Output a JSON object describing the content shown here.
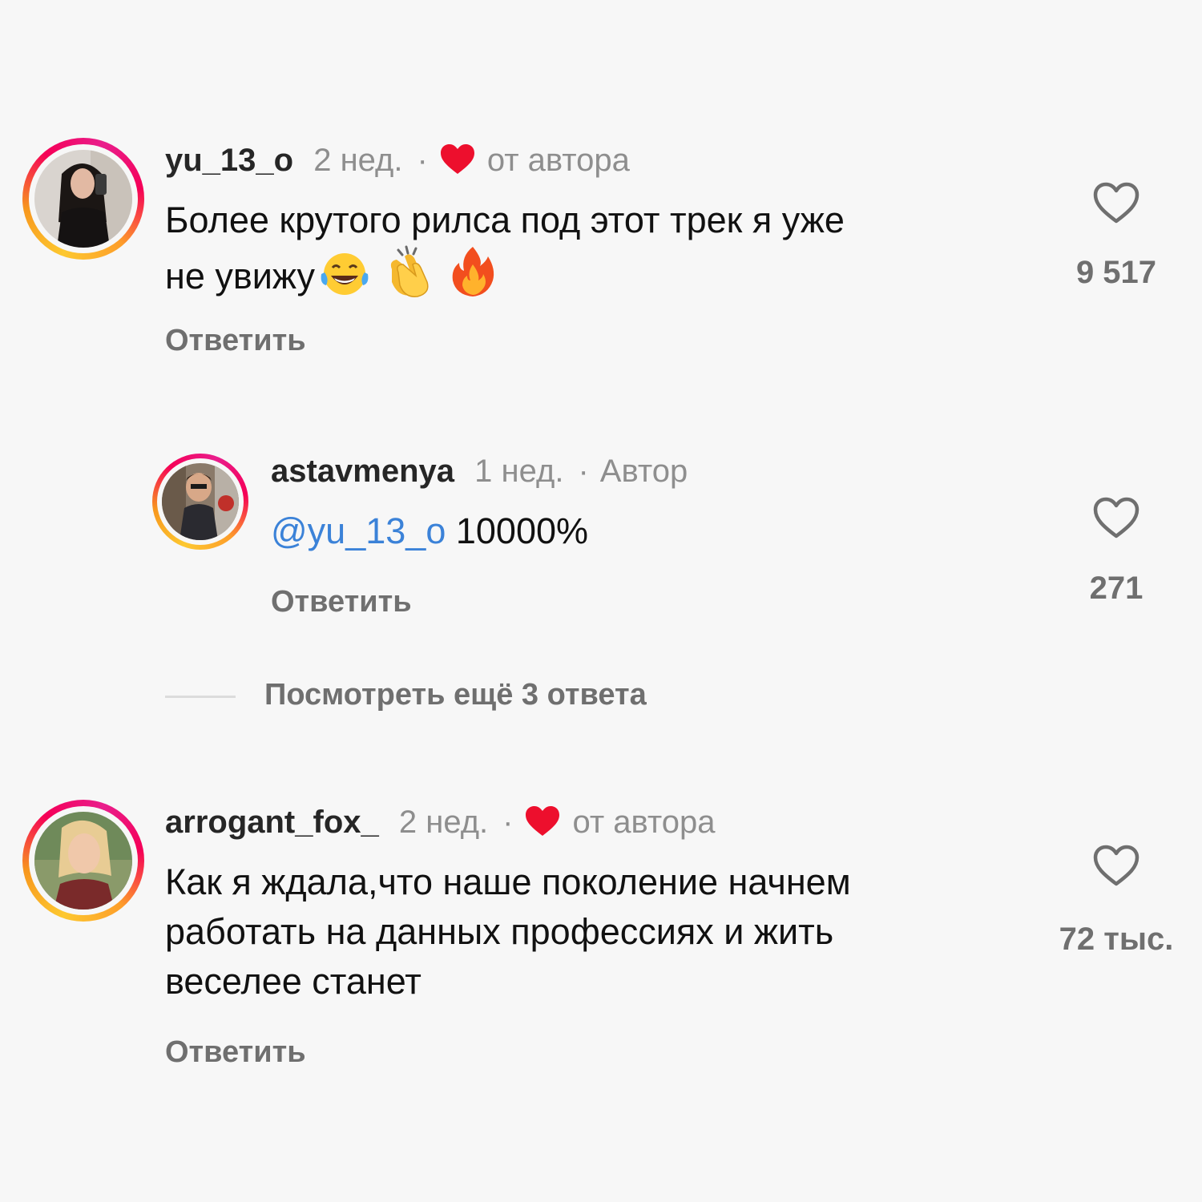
{
  "comments": [
    {
      "username": "yu_13_o",
      "time": "2 нед.",
      "separator": "·",
      "author_like_label": "от автора",
      "text_line1": "Более крутого рилса под этот трек я уже",
      "text_line2": "не увижу",
      "emojis": [
        "tears-of-joy-emoji",
        "clapping-hands-emoji",
        "fire-emoji"
      ],
      "reply_label": "Ответить",
      "likes": "9 517"
    },
    {
      "username": "astavmenya",
      "time": "1 нед.",
      "separator": "·",
      "author_badge": "Автор",
      "mention": "@yu_13_o",
      "text": "10000%",
      "reply_label": "Ответить",
      "likes": "271"
    },
    {
      "username": "arrogant_fox_",
      "time": "2 нед.",
      "separator": "·",
      "author_like_label": "от автора",
      "text_line1": "Как я ждала,что наше поколение начнем",
      "text_line2": "работать на данных профессиях и жить",
      "text_line3": "веселее станет",
      "reply_label": "Ответить",
      "likes": "72 тыс."
    }
  ],
  "view_more_replies": "Посмотреть ещё 3 ответа",
  "colors": {
    "background": "#f7f7f7",
    "heart_red": "#ed0f2d",
    "mention_blue": "#3b82d8",
    "secondary_text": "#8e8e8e"
  }
}
